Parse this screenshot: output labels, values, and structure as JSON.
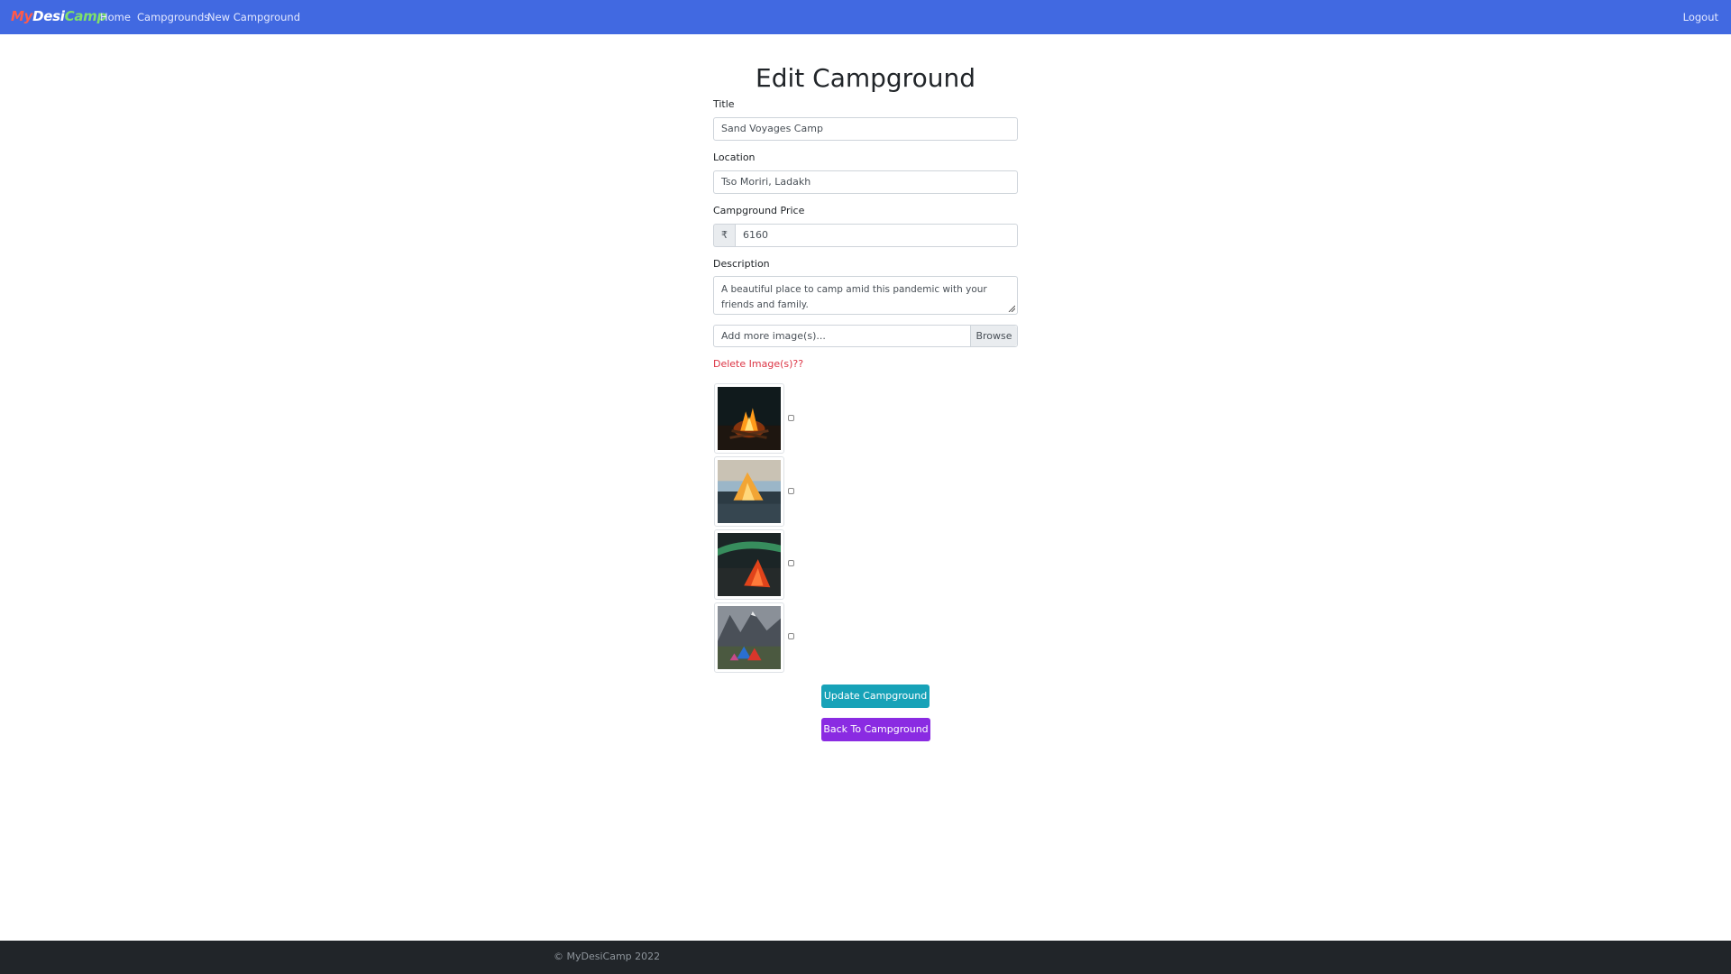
{
  "navbar": {
    "brand": {
      "part1": "My",
      "part2": "Desi",
      "part3": "Camp"
    },
    "links": {
      "home": "Home",
      "campgrounds": "Campgrounds",
      "new_campground": "New Campground"
    },
    "logout": "Logout",
    "bg_color": "#4169e1"
  },
  "form": {
    "heading": "Edit Campground",
    "title": {
      "label": "Title",
      "value": "Sand Voyages Camp"
    },
    "location": {
      "label": "Location",
      "value": "Tso Moriri, Ladakh"
    },
    "price": {
      "label": "Campground Price",
      "prepend": "₹",
      "value": "6160"
    },
    "description": {
      "label": "Description",
      "value": "A beautiful place to camp amid this pandemic with your friends and family."
    },
    "images_input": {
      "placeholder": "Add more image(s)...",
      "browse_label": "Browse"
    },
    "delete_label": "Delete Image(s)??",
    "images": [
      {
        "name": "campfire-image",
        "checked": false
      },
      {
        "name": "tent-at-dusk-image",
        "checked": false
      },
      {
        "name": "aurora-tent-image",
        "checked": false
      },
      {
        "name": "mountain-tents-image",
        "checked": false
      }
    ]
  },
  "buttons": {
    "update": "Update Campground",
    "back": "Back To Campground",
    "update_color": "#17a2b8",
    "back_color": "#8a2be2"
  },
  "footer": {
    "text": "© MyDesiCamp 2022"
  }
}
